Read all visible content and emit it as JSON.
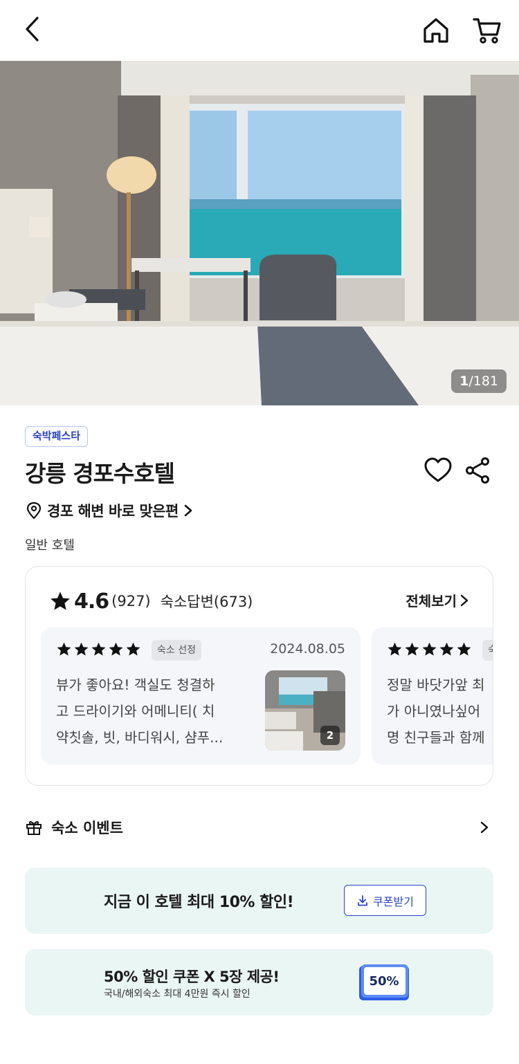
{
  "topbar": {
    "back_icon": "chevron-left-icon",
    "home_icon": "home-icon",
    "cart_icon": "cart-icon"
  },
  "hero": {
    "current": "1",
    "total": "/181"
  },
  "hotel": {
    "badge": "숙박페스타",
    "name": "강릉 경포수호텔",
    "location": "경포 해변 바로 맞은편",
    "category": "일반 호텔"
  },
  "reviews": {
    "score": "4.6",
    "count": "(927)",
    "reply": "숙소답변(673)",
    "view_all": "전체보기",
    "items": [
      {
        "badge": "숙소 선정",
        "date": "2024.08.05",
        "lines": [
          "뷰가 좋아요! 객실도 청결하",
          "고 드라이기와 어메니티( 치",
          "약칫솔, 빗, 바디워시, 샴푸..."
        ],
        "photo_count": "2"
      },
      {
        "badge": "숙",
        "lines": [
          "정말 바닷가앞 최",
          "가 아니였나싶어",
          "명 친구들과 함께"
        ]
      }
    ]
  },
  "event": {
    "title": "숙소 이벤트"
  },
  "promos": {
    "one_text": "지금 이 호텔 최대 10% 할인!",
    "coupon_button": "쿠폰받기",
    "two_title": "50% 할인 쿠폰 X 5장 제공!",
    "two_sub": "국내/해외숙소 최대 4만원 즉시 할인",
    "coupon_card": "50%"
  },
  "colors": {
    "accent": "#2a44c4",
    "promo_bg": "#eaf6f3",
    "review_bg": "#f4f6fa"
  }
}
